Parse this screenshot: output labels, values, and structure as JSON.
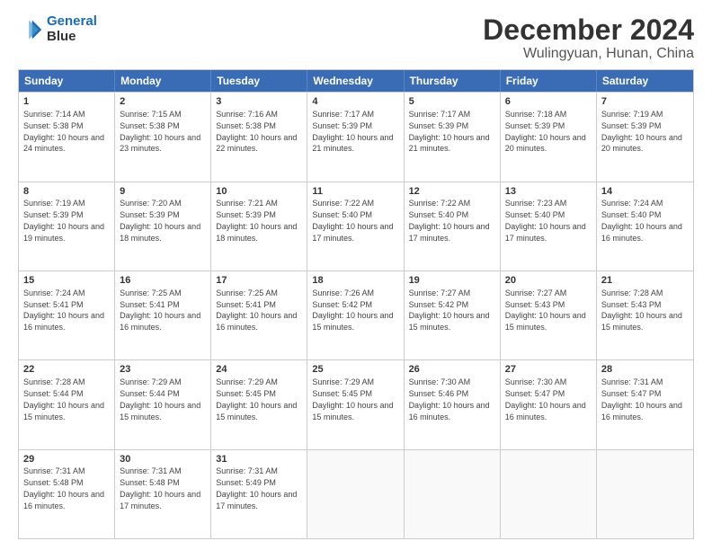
{
  "logo": {
    "line1": "General",
    "line2": "Blue"
  },
  "title": "December 2024",
  "location": "Wulingyuan, Hunan, China",
  "days": [
    "Sunday",
    "Monday",
    "Tuesday",
    "Wednesday",
    "Thursday",
    "Friday",
    "Saturday"
  ],
  "weeks": [
    [
      {
        "day": "1",
        "sunrise": "7:14 AM",
        "sunset": "5:38 PM",
        "daylight": "10 hours and 24 minutes."
      },
      {
        "day": "2",
        "sunrise": "7:15 AM",
        "sunset": "5:38 PM",
        "daylight": "10 hours and 23 minutes."
      },
      {
        "day": "3",
        "sunrise": "7:16 AM",
        "sunset": "5:38 PM",
        "daylight": "10 hours and 22 minutes."
      },
      {
        "day": "4",
        "sunrise": "7:17 AM",
        "sunset": "5:39 PM",
        "daylight": "10 hours and 21 minutes."
      },
      {
        "day": "5",
        "sunrise": "7:17 AM",
        "sunset": "5:39 PM",
        "daylight": "10 hours and 21 minutes."
      },
      {
        "day": "6",
        "sunrise": "7:18 AM",
        "sunset": "5:39 PM",
        "daylight": "10 hours and 20 minutes."
      },
      {
        "day": "7",
        "sunrise": "7:19 AM",
        "sunset": "5:39 PM",
        "daylight": "10 hours and 20 minutes."
      }
    ],
    [
      {
        "day": "8",
        "sunrise": "7:19 AM",
        "sunset": "5:39 PM",
        "daylight": "10 hours and 19 minutes."
      },
      {
        "day": "9",
        "sunrise": "7:20 AM",
        "sunset": "5:39 PM",
        "daylight": "10 hours and 18 minutes."
      },
      {
        "day": "10",
        "sunrise": "7:21 AM",
        "sunset": "5:39 PM",
        "daylight": "10 hours and 18 minutes."
      },
      {
        "day": "11",
        "sunrise": "7:22 AM",
        "sunset": "5:40 PM",
        "daylight": "10 hours and 17 minutes."
      },
      {
        "day": "12",
        "sunrise": "7:22 AM",
        "sunset": "5:40 PM",
        "daylight": "10 hours and 17 minutes."
      },
      {
        "day": "13",
        "sunrise": "7:23 AM",
        "sunset": "5:40 PM",
        "daylight": "10 hours and 17 minutes."
      },
      {
        "day": "14",
        "sunrise": "7:24 AM",
        "sunset": "5:40 PM",
        "daylight": "10 hours and 16 minutes."
      }
    ],
    [
      {
        "day": "15",
        "sunrise": "7:24 AM",
        "sunset": "5:41 PM",
        "daylight": "10 hours and 16 minutes."
      },
      {
        "day": "16",
        "sunrise": "7:25 AM",
        "sunset": "5:41 PM",
        "daylight": "10 hours and 16 minutes."
      },
      {
        "day": "17",
        "sunrise": "7:25 AM",
        "sunset": "5:41 PM",
        "daylight": "10 hours and 16 minutes."
      },
      {
        "day": "18",
        "sunrise": "7:26 AM",
        "sunset": "5:42 PM",
        "daylight": "10 hours and 15 minutes."
      },
      {
        "day": "19",
        "sunrise": "7:27 AM",
        "sunset": "5:42 PM",
        "daylight": "10 hours and 15 minutes."
      },
      {
        "day": "20",
        "sunrise": "7:27 AM",
        "sunset": "5:43 PM",
        "daylight": "10 hours and 15 minutes."
      },
      {
        "day": "21",
        "sunrise": "7:28 AM",
        "sunset": "5:43 PM",
        "daylight": "10 hours and 15 minutes."
      }
    ],
    [
      {
        "day": "22",
        "sunrise": "7:28 AM",
        "sunset": "5:44 PM",
        "daylight": "10 hours and 15 minutes."
      },
      {
        "day": "23",
        "sunrise": "7:29 AM",
        "sunset": "5:44 PM",
        "daylight": "10 hours and 15 minutes."
      },
      {
        "day": "24",
        "sunrise": "7:29 AM",
        "sunset": "5:45 PM",
        "daylight": "10 hours and 15 minutes."
      },
      {
        "day": "25",
        "sunrise": "7:29 AM",
        "sunset": "5:45 PM",
        "daylight": "10 hours and 15 minutes."
      },
      {
        "day": "26",
        "sunrise": "7:30 AM",
        "sunset": "5:46 PM",
        "daylight": "10 hours and 16 minutes."
      },
      {
        "day": "27",
        "sunrise": "7:30 AM",
        "sunset": "5:47 PM",
        "daylight": "10 hours and 16 minutes."
      },
      {
        "day": "28",
        "sunrise": "7:31 AM",
        "sunset": "5:47 PM",
        "daylight": "10 hours and 16 minutes."
      }
    ],
    [
      {
        "day": "29",
        "sunrise": "7:31 AM",
        "sunset": "5:48 PM",
        "daylight": "10 hours and 16 minutes."
      },
      {
        "day": "30",
        "sunrise": "7:31 AM",
        "sunset": "5:48 PM",
        "daylight": "10 hours and 17 minutes."
      },
      {
        "day": "31",
        "sunrise": "7:31 AM",
        "sunset": "5:49 PM",
        "daylight": "10 hours and 17 minutes."
      },
      null,
      null,
      null,
      null
    ]
  ]
}
